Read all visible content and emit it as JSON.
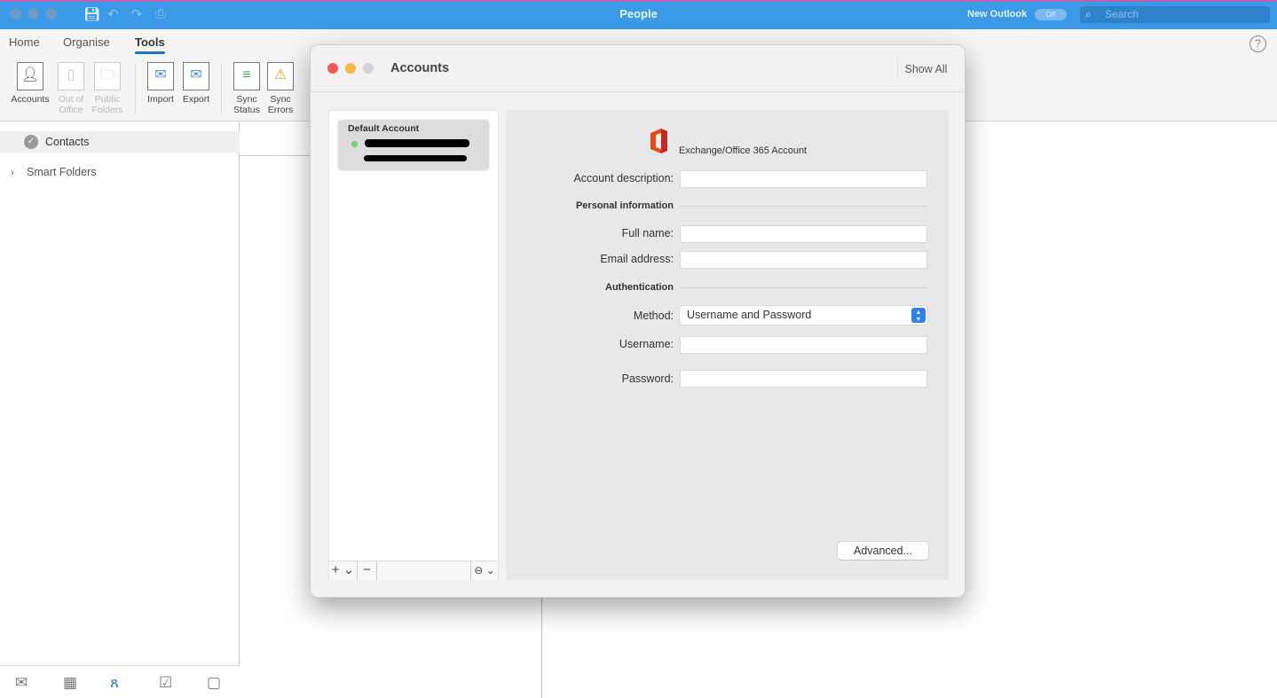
{
  "window": {
    "title": "People",
    "new_outlook_label": "New Outlook",
    "new_outlook_toggle": "Off",
    "search_placeholder": "Search"
  },
  "ribbon": {
    "tabs": [
      {
        "label": "Home"
      },
      {
        "label": "Organise"
      },
      {
        "label": "Tools",
        "active": true
      }
    ],
    "buttons": [
      {
        "label1": "Accounts",
        "label2": "",
        "icon": "person-icon",
        "enabled": true
      },
      {
        "label1": "Out of",
        "label2": "Office",
        "icon": "door-icon",
        "enabled": false
      },
      {
        "label1": "Public",
        "label2": "Folders",
        "icon": "folder-people-icon",
        "enabled": false
      },
      {
        "label1": "Import",
        "label2": "",
        "icon": "envelope-import-icon",
        "enabled": true
      },
      {
        "label1": "Export",
        "label2": "",
        "icon": "envelope-export-icon",
        "enabled": true
      },
      {
        "label1": "Sync",
        "label2": "Status",
        "icon": "sync-status-icon",
        "enabled": true
      },
      {
        "label1": "Sync",
        "label2": "Errors",
        "icon": "warning-icon",
        "enabled": true
      }
    ]
  },
  "sidebar": {
    "contacts": "Contacts",
    "smart_folders": "Smart Folders"
  },
  "bottom_nav": [
    "mail-icon",
    "calendar-icon",
    "people-icon",
    "tasks-icon",
    "notes-icon"
  ],
  "dialog": {
    "title": "Accounts",
    "show_all": "Show All",
    "account_list": {
      "default_title": "Default Account",
      "status_color": "#6dd36a"
    },
    "account_type": "Exchange/Office 365 Account",
    "fields": {
      "account_description": {
        "label": "Account description:",
        "value": ""
      },
      "personal_information": "Personal information",
      "full_name": {
        "label": "Full name:",
        "value": ""
      },
      "email_address": {
        "label": "Email address:",
        "value": ""
      },
      "authentication": "Authentication",
      "method": {
        "label": "Method:",
        "value": "Username and Password"
      },
      "username": {
        "label": "Username:",
        "value": ""
      },
      "password": {
        "label": "Password:",
        "value": ""
      }
    },
    "advanced_button": "Advanced...",
    "footer": {
      "add": "+ ⌄",
      "remove": "−",
      "more": "⊖ ⌄"
    }
  },
  "colors": {
    "titlebar": "#3a9ae8",
    "accent": "#1b74c9",
    "method_arrow": "#2f7ff1"
  }
}
